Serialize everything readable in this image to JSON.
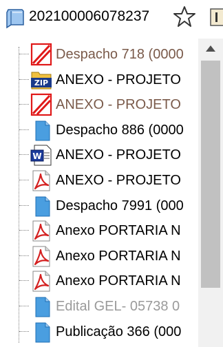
{
  "header": {
    "process_number": "202100006078237"
  },
  "tree": {
    "items": [
      {
        "label": "Despacho 718 (0000",
        "icon": "cancelled-document-icon",
        "state": "visited"
      },
      {
        "label": "ANEXO - PROJETO",
        "icon": "zip-file-icon",
        "state": "normal"
      },
      {
        "label": "ANEXO - PROJETO",
        "icon": "cancelled-document-icon",
        "state": "visited"
      },
      {
        "label": "Despacho 886 (0000",
        "icon": "document-icon",
        "state": "normal"
      },
      {
        "label": "ANEXO - PROJETO",
        "icon": "word-file-icon",
        "state": "normal"
      },
      {
        "label": "ANEXO - PROJETO",
        "icon": "pdf-file-icon",
        "state": "normal"
      },
      {
        "label": "Despacho 7991 (000",
        "icon": "document-icon",
        "state": "normal"
      },
      {
        "label": "Anexo PORTARIA N",
        "icon": "pdf-file-icon",
        "state": "normal"
      },
      {
        "label": "Anexo PORTARIA N",
        "icon": "pdf-file-icon",
        "state": "normal"
      },
      {
        "label": "Anexo PORTARIA N",
        "icon": "pdf-file-icon",
        "state": "normal"
      },
      {
        "label": "Edital GEL- 05738 0",
        "icon": "document-icon",
        "state": "disabled"
      },
      {
        "label": "Publicação 366 (000",
        "icon": "document-icon",
        "state": "normal"
      }
    ]
  },
  "colors": {
    "visited_text": "#7a5a4a",
    "disabled_text": "#9a9a9a",
    "doc_blue": "#4a9ee0",
    "cancel_red": "#e01818",
    "pdf_red": "#d42020"
  }
}
